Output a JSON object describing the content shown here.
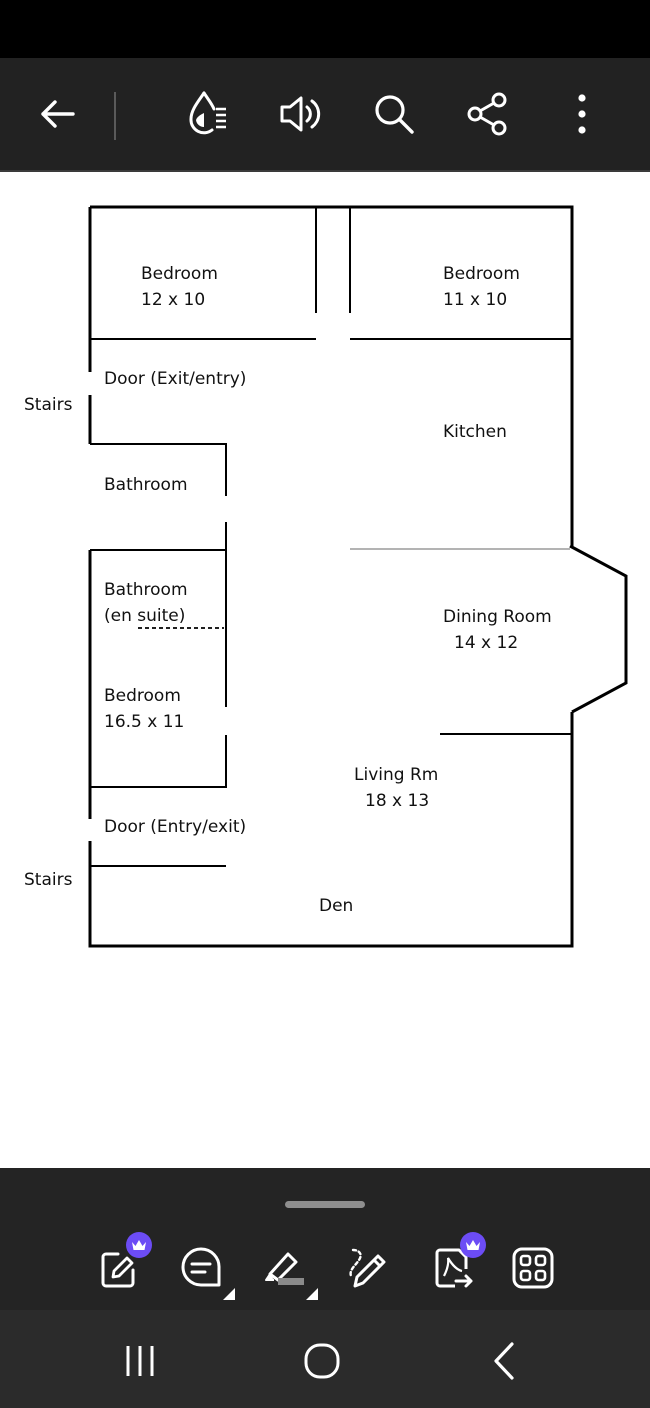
{
  "toolbar": {
    "back": "back-arrow-icon",
    "reading_mode": "reading-mode-icon",
    "read_aloud": "speaker-icon",
    "search": "search-icon",
    "share": "share-icon",
    "more": "more-vertical-icon"
  },
  "floor_plan": {
    "labels": {
      "bedroom_1_name": "Bedroom",
      "bedroom_1_size": "12 x 10",
      "bedroom_2_name": "Bedroom",
      "bedroom_2_size": "11 x 10",
      "door_exit_entry": "Door (Exit/entry)",
      "stairs_top": "Stairs",
      "kitchen": "Kitchen",
      "bathroom": "Bathroom",
      "bathroom_ensuite_line1": "Bathroom",
      "bathroom_ensuite_line2": "(en suite)",
      "dining_name": "Dining Room",
      "dining_size": "14 x 12",
      "bedroom_3_name": "Bedroom",
      "bedroom_3_size": "16.5 x 11",
      "living_name": "Living Rm",
      "living_size": "18 x 13",
      "door_entry_exit": "Door (Entry/exit)",
      "stairs_bottom": "Stairs",
      "den": "Den"
    }
  },
  "bottom_toolbar": {
    "tools": [
      "edit-pdf-icon",
      "comment-icon",
      "highlighter-icon",
      "draw-pen-icon",
      "export-pdf-icon",
      "all-tools-icon"
    ],
    "premium_tools": [
      "edit-pdf-icon",
      "export-pdf-icon"
    ]
  },
  "nav": {
    "recents": "recents-icon",
    "home": "home-icon",
    "back": "nav-back-icon"
  },
  "colors": {
    "toolbar_bg": "#222222",
    "icon": "#ffffff",
    "premium_badge": "#6c4cf5",
    "nav_bg": "#2b2b2b"
  }
}
